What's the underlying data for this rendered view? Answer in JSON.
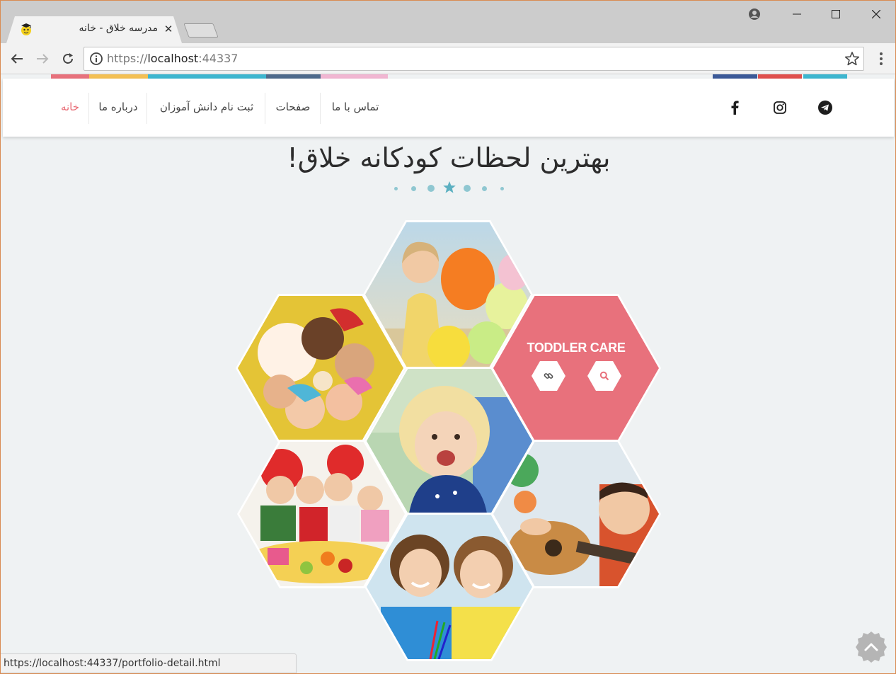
{
  "browser": {
    "tab_title": "مدرسه خلاق - خانه",
    "tab_close": "✕",
    "url_scheme": "https://",
    "url_host": "localhost",
    "url_port": ":44337",
    "status_url": "https://localhost:44337/portfolio-detail.html"
  },
  "header": {
    "nav": [
      {
        "label": "خانه",
        "active": true
      },
      {
        "label": "درباره ما"
      },
      {
        "label": "ثبت نام دانش آموزان"
      },
      {
        "label": "صفحات"
      },
      {
        "label": "تماس با ما"
      }
    ],
    "social": [
      "telegram-icon",
      "instagram-icon",
      "facebook-icon"
    ]
  },
  "hero": {
    "title": "بهترین لحظات کودکانه خلاق!"
  },
  "gallery": {
    "highlight_title": "TODDLER CARE",
    "highlight_buttons": [
      "link-icon",
      "search-icon"
    ]
  },
  "colors": {
    "accent": "#e8717c",
    "divider": "#8fc7d1",
    "strip": [
      "#e8717c",
      "#f3c053",
      "#3db6cf",
      "#4e6a8b",
      "#f1b6d2",
      "#3b5998",
      "#e0504d",
      "#3db6cf"
    ]
  }
}
